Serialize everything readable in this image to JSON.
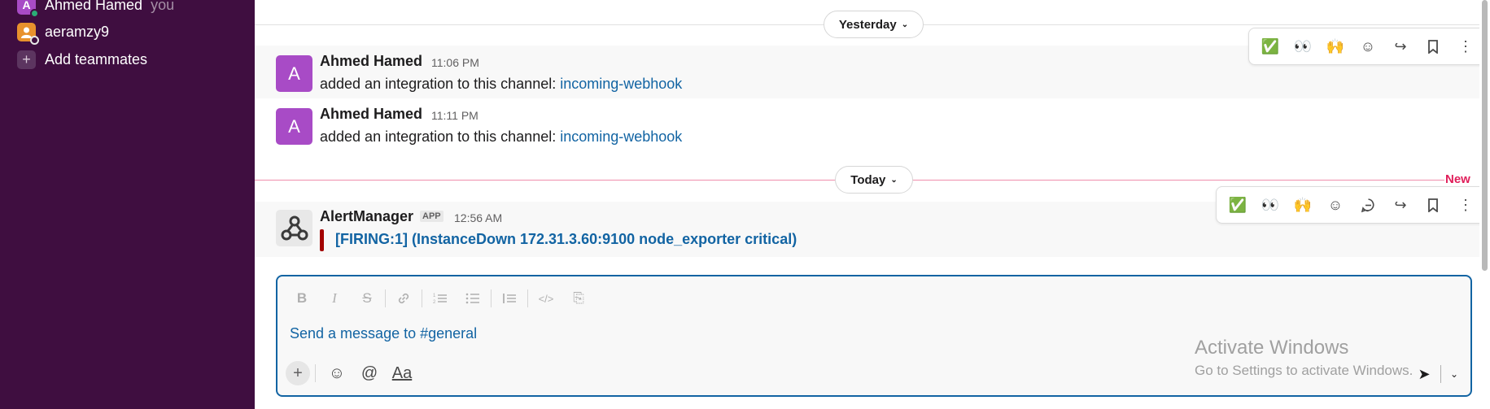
{
  "sidebar": {
    "members": [
      {
        "name": "Ahmed Hamed",
        "suffix": "you",
        "initial": "A",
        "status_color": "#2bac76"
      },
      {
        "name": "aeramzy9",
        "initial": "",
        "status_color": "#e8912d"
      }
    ],
    "add_teammates": "Add teammates"
  },
  "divider_yesterday": {
    "label": "Yesterday",
    "chevron": "⌄"
  },
  "divider_today": {
    "label": "Today",
    "chevron": "⌄",
    "new_label": "New"
  },
  "messages": [
    {
      "author": "Ahmed Hamed",
      "initial": "A",
      "time": "11:06 PM",
      "text": "added an integration to this channel: ",
      "link": "incoming-webhook"
    },
    {
      "author": "Ahmed Hamed",
      "initial": "A",
      "time": "11:11 PM",
      "text": "added an integration to this channel: ",
      "link": "incoming-webhook"
    },
    {
      "author": "AlertManager",
      "badge": "APP",
      "time": "12:56 AM",
      "alert": "[FIRING:1]  (InstanceDown 172.31.3.60:9100 node_exporter critical)",
      "alert_color": "#a30200"
    }
  ],
  "toolbar_icons": {
    "check": "✅",
    "eyes": "👀",
    "raised_hands": "🙌",
    "add_reaction": "☺",
    "reply_thread": "💬",
    "forward": "↪",
    "bookmark": "🔖",
    "more": "⋮"
  },
  "composer": {
    "placeholder": "Send a message to #general",
    "format": {
      "bold": "B",
      "italic": "I",
      "strike": "S",
      "link": "🔗",
      "ordered": "☰",
      "bullet": "☰",
      "quote": "☰",
      "code": "</>",
      "codeblock": "⎘"
    },
    "plus": "+",
    "emoji": "☺",
    "mention": "@",
    "text_format": "Aa",
    "send": "➤",
    "send_options": "⌄"
  },
  "watermark": {
    "title": "Activate Windows",
    "subtitle": "Go to Settings to activate Windows."
  },
  "colors": {
    "sidebar_bg": "#3f0e40",
    "link": "#1264a3",
    "new": "#e01e5a",
    "avatar_purple": "#a84bc6"
  }
}
